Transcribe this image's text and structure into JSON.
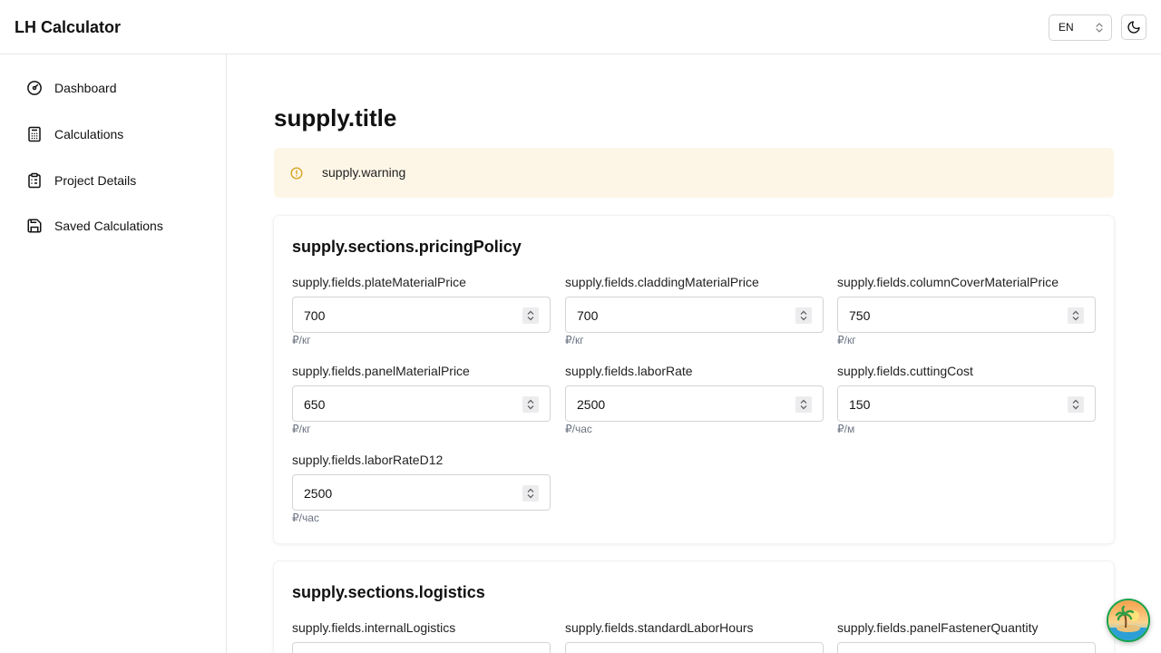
{
  "header": {
    "app_title": "LH Calculator",
    "language": "EN"
  },
  "sidebar": {
    "items": [
      {
        "label": "Dashboard",
        "icon": "gauge-icon"
      },
      {
        "label": "Calculations",
        "icon": "calculator-icon"
      },
      {
        "label": "Project Details",
        "icon": "clipboard-icon"
      },
      {
        "label": "Saved Calculations",
        "icon": "save-icon"
      }
    ]
  },
  "main": {
    "title": "supply.title",
    "warning": "supply.warning",
    "sections": [
      {
        "title": "supply.sections.pricingPolicy",
        "fields": [
          {
            "label": "supply.fields.plateMaterialPrice",
            "value": "700",
            "unit": "₽/кг"
          },
          {
            "label": "supply.fields.claddingMaterialPrice",
            "value": "700",
            "unit": "₽/кг"
          },
          {
            "label": "supply.fields.columnCoverMaterialPrice",
            "value": "750",
            "unit": "₽/кг"
          },
          {
            "label": "supply.fields.panelMaterialPrice",
            "value": "650",
            "unit": "₽/кг"
          },
          {
            "label": "supply.fields.laborRate",
            "value": "2500",
            "unit": "₽/час"
          },
          {
            "label": "supply.fields.cuttingCost",
            "value": "150",
            "unit": "₽/м"
          },
          {
            "label": "supply.fields.laborRateD12",
            "value": "2500",
            "unit": "₽/час"
          }
        ]
      },
      {
        "title": "supply.sections.logistics",
        "fields": [
          {
            "label": "supply.fields.internalLogistics"
          },
          {
            "label": "supply.fields.standardLaborHours"
          },
          {
            "label": "supply.fields.panelFastenerQuantity"
          }
        ]
      }
    ]
  },
  "colors": {
    "warning_bg": "#fdf6e7",
    "warning_icon": "#d4a017",
    "fab_border": "#16a34a"
  }
}
